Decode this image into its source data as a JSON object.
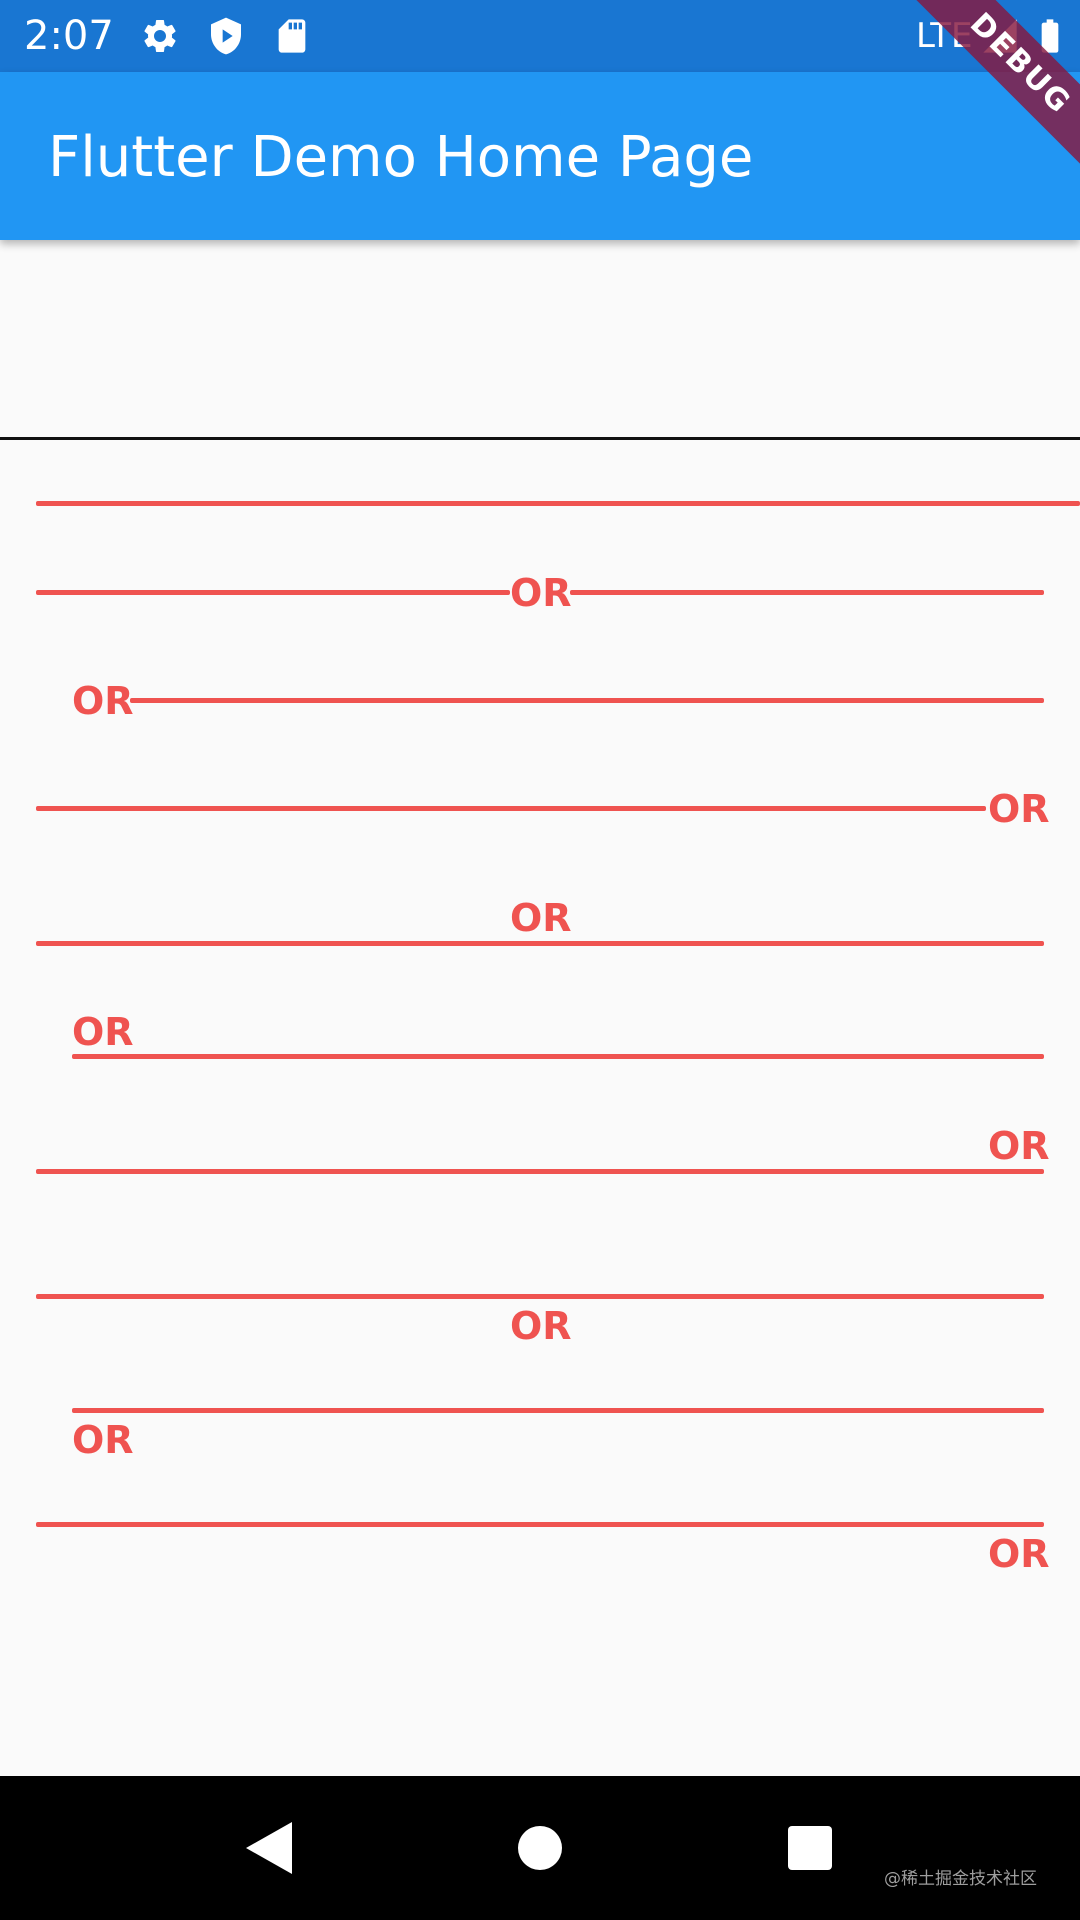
{
  "status_bar": {
    "time": "2:07",
    "network": "LTE",
    "icons": [
      "settings-icon",
      "play-protect-icon",
      "sd-card-icon",
      "signal-icon",
      "battery-icon"
    ]
  },
  "app_bar": {
    "title": "Flutter Demo Home Page"
  },
  "debug_banner": {
    "label": "DEBUG"
  },
  "content": {
    "accent_color": "#ef5350",
    "divider_labels": [
      "OR",
      "OR",
      "OR",
      "OR",
      "OR",
      "OR",
      "OR",
      "OR",
      "OR"
    ]
  },
  "nav_bar": {
    "buttons": [
      "back-button",
      "home-button",
      "recents-button"
    ],
    "watermark": "@稀土掘金技术社区"
  },
  "colors": {
    "status_bar": "#1976d2",
    "app_bar": "#2196f3",
    "background": "#fafafa",
    "accent": "#ef5350"
  }
}
